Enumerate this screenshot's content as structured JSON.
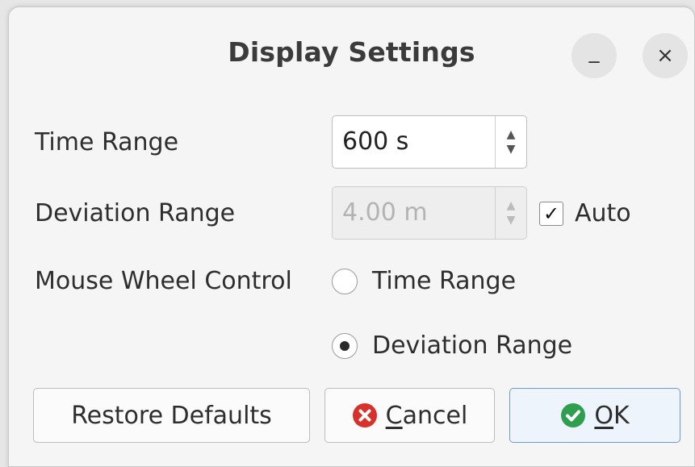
{
  "window": {
    "title": "Display Settings",
    "minimize_glyph": "_",
    "close_glyph": "×"
  },
  "time_range": {
    "label": "Time Range",
    "value": "600 s"
  },
  "deviation_range": {
    "label": "Deviation Range",
    "value": "4.00 m",
    "disabled": true,
    "auto_label": "Auto",
    "auto_checked": true
  },
  "mouse_wheel": {
    "label": "Mouse Wheel Control",
    "options": [
      {
        "label": "Time Range",
        "selected": false
      },
      {
        "label": "Deviation Range",
        "selected": true
      }
    ]
  },
  "buttons": {
    "restore_label": "Restore Defaults",
    "cancel_mnemonic": "C",
    "cancel_rest": "ancel",
    "ok_mnemonic": "O",
    "ok_rest": "K"
  },
  "icons": {
    "cancel": "cancel-icon",
    "ok": "ok-icon"
  },
  "colors": {
    "cancel_icon": "#d9302c",
    "ok_icon": "#2e9e4f",
    "default_button_border": "#6b9bd6"
  }
}
